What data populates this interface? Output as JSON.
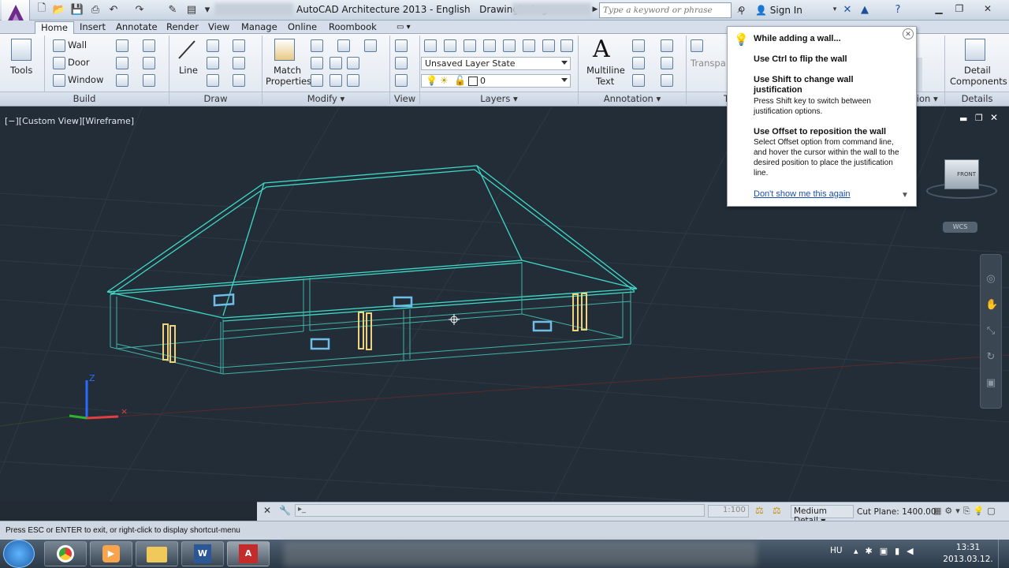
{
  "app": {
    "title": "AutoCAD Architecture 2013 - English",
    "document": "Drawing1.dwg"
  },
  "titlebar": {
    "search_placeholder": "Type a keyword or phrase",
    "sign_in": "Sign In"
  },
  "tabs": [
    "Home",
    "Insert",
    "Annotate",
    "Render",
    "View",
    "Manage",
    "Online",
    "Roombook"
  ],
  "ribbon": {
    "tools_label": "Tools",
    "build": {
      "wall": "Wall",
      "door": "Door",
      "window": "Window",
      "panel": "Build"
    },
    "draw": {
      "line": "Line",
      "panel": "Draw"
    },
    "modify": {
      "match": "Match",
      "properties": "Properties",
      "panel": "Modify"
    },
    "view": {
      "panel": "View"
    },
    "layers": {
      "layer_state": "Unsaved Layer State",
      "current_layer": "0",
      "panel": "Layers"
    },
    "annotation": {
      "multiline": "Multiline",
      "text": "Text",
      "panel": "Annotation"
    },
    "partial": {
      "transparency": "Transpa",
      "t_label": "T",
      "tion": "tion"
    },
    "details": {
      "detail": "Detail",
      "components": "Components",
      "panel": "Details"
    }
  },
  "viewport": {
    "label": "[−][Custom View][Wireframe]",
    "viewcube_face": "FRONT",
    "wcs": "WCS",
    "axis_z": "Z"
  },
  "tooltip": {
    "heading": "While adding a wall...",
    "tip1_title": "Use Ctrl to flip the wall",
    "tip2_title": "Use Shift to change wall justification",
    "tip2_body": "Press Shift key to switch between justification options.",
    "tip3_title": "Use Offset to reposition the wall",
    "tip3_body": "Select Offset option from command line, and hover the cursor within the wall to the desired position to place the justification line.",
    "dismiss_link": "Don't show me this again"
  },
  "statusbar": {
    "message": "Press ESC or ENTER to exit, or right-click to display shortcut-menu",
    "scale": "1:100",
    "detail": "Medium Detail",
    "cut_plane": "Cut Plane: 1400.00"
  },
  "taskbar": {
    "lang": "HU",
    "time": "13:31",
    "date": "2013.03.12."
  },
  "colors": {
    "viewport_bg": "#232d37",
    "wireframe": "#3fd9c8",
    "window_blue": "#6fbde8",
    "door_yellow": "#f0d27a"
  }
}
